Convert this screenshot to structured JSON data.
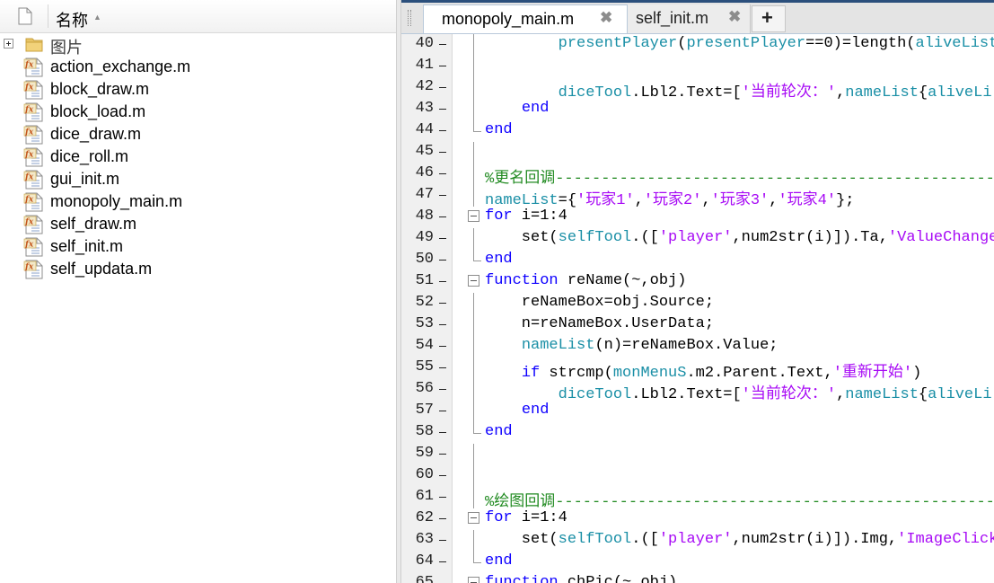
{
  "browser": {
    "header": {
      "name_label": "名称",
      "sort_glyph": "▲"
    },
    "folder": {
      "label": "图片",
      "icon": "folder-icon",
      "expander": "plus"
    },
    "files": [
      "action_exchange.m",
      "block_draw.m",
      "block_load.m",
      "dice_draw.m",
      "dice_roll.m",
      "gui_init.m",
      "monopoly_main.m",
      "self_draw.m",
      "self_init.m",
      "self_updata.m"
    ],
    "file_icon": "matlab-function-icon"
  },
  "editor": {
    "tabs": [
      {
        "label": "monopoly_main.m",
        "active": true
      },
      {
        "label": "self_init.m",
        "active": false
      }
    ],
    "close_glyph": "✖",
    "new_tab_glyph": "+",
    "lines": [
      {
        "n": "40",
        "segments": [
          [
            "plain",
            "        "
          ],
          [
            "var2",
            "presentPlayer"
          ],
          [
            "plain",
            "("
          ],
          [
            "var2",
            "presentPlayer"
          ],
          [
            "plain",
            "==0)=length("
          ],
          [
            "var2",
            "aliveList"
          ],
          [
            "plain",
            ")"
          ]
        ]
      },
      {
        "n": "41",
        "segments": []
      },
      {
        "n": "42",
        "segments": [
          [
            "plain",
            "        "
          ],
          [
            "var2",
            "diceTool"
          ],
          [
            "plain",
            ".Lbl2.Text=["
          ],
          [
            "str",
            "'当前轮次：'"
          ],
          [
            "plain",
            ","
          ],
          [
            "var2",
            "nameList"
          ],
          [
            "plain",
            "{"
          ],
          [
            "var2",
            "aliveLi"
          ]
        ]
      },
      {
        "n": "43",
        "segments": [
          [
            "plain",
            "    "
          ],
          [
            "kw",
            "end"
          ]
        ]
      },
      {
        "n": "44",
        "segments": [
          [
            "kw",
            "end"
          ]
        ]
      },
      {
        "n": "45",
        "segments": []
      },
      {
        "n": "46",
        "segments": [
          [
            "cmt",
            "%更名回调--------------------------------------------------"
          ]
        ]
      },
      {
        "n": "47",
        "segments": [
          [
            "var2",
            "nameList"
          ],
          [
            "plain",
            "={"
          ],
          [
            "str",
            "'玩家1'"
          ],
          [
            "plain",
            ","
          ],
          [
            "str",
            "'玩家2'"
          ],
          [
            "plain",
            ","
          ],
          [
            "str",
            "'玩家3'"
          ],
          [
            "plain",
            ","
          ],
          [
            "str",
            "'玩家4'"
          ],
          [
            "plain",
            "};"
          ]
        ]
      },
      {
        "n": "48",
        "segments": [
          [
            "kw",
            "for"
          ],
          [
            "plain",
            " i=1:4"
          ]
        ]
      },
      {
        "n": "49",
        "segments": [
          [
            "plain",
            "    set("
          ],
          [
            "var2",
            "selfTool"
          ],
          [
            "plain",
            ".(["
          ],
          [
            "str",
            "'player'"
          ],
          [
            "plain",
            ",num2str(i)]).Ta,"
          ],
          [
            "str",
            "'ValueChanged"
          ]
        ]
      },
      {
        "n": "50",
        "segments": [
          [
            "kw",
            "end"
          ]
        ]
      },
      {
        "n": "51",
        "segments": [
          [
            "kw",
            "function"
          ],
          [
            "plain",
            " reName(~,obj)"
          ]
        ]
      },
      {
        "n": "52",
        "segments": [
          [
            "plain",
            "    reNameBox=obj.Source;"
          ]
        ]
      },
      {
        "n": "53",
        "segments": [
          [
            "plain",
            "    n=reNameBox.UserData;"
          ]
        ]
      },
      {
        "n": "54",
        "segments": [
          [
            "plain",
            "    "
          ],
          [
            "var2",
            "nameList"
          ],
          [
            "plain",
            "(n)=reNameBox.Value;"
          ]
        ]
      },
      {
        "n": "55",
        "segments": [
          [
            "plain",
            "    "
          ],
          [
            "kw",
            "if"
          ],
          [
            "plain",
            " strcmp("
          ],
          [
            "var2",
            "monMenuS"
          ],
          [
            "plain",
            ".m2.Parent.Text,"
          ],
          [
            "str",
            "'重新开始'"
          ],
          [
            "plain",
            ")"
          ]
        ]
      },
      {
        "n": "56",
        "segments": [
          [
            "plain",
            "        "
          ],
          [
            "var2",
            "diceTool"
          ],
          [
            "plain",
            ".Lbl2.Text=["
          ],
          [
            "str",
            "'当前轮次：'"
          ],
          [
            "plain",
            ","
          ],
          [
            "var2",
            "nameList"
          ],
          [
            "plain",
            "{"
          ],
          [
            "var2",
            "aliveLi"
          ]
        ]
      },
      {
        "n": "57",
        "segments": [
          [
            "plain",
            "    "
          ],
          [
            "kw",
            "end"
          ]
        ]
      },
      {
        "n": "58",
        "segments": [
          [
            "kw",
            "end"
          ]
        ]
      },
      {
        "n": "59",
        "segments": []
      },
      {
        "n": "60",
        "segments": []
      },
      {
        "n": "61",
        "segments": [
          [
            "cmt",
            "%绘图回调--------------------------------------------------"
          ]
        ]
      },
      {
        "n": "62",
        "segments": [
          [
            "kw",
            "for"
          ],
          [
            "plain",
            " i=1:4"
          ]
        ]
      },
      {
        "n": "63",
        "segments": [
          [
            "plain",
            "    set("
          ],
          [
            "var2",
            "selfTool"
          ],
          [
            "plain",
            ".(["
          ],
          [
            "str",
            "'player'"
          ],
          [
            "plain",
            ",num2str(i)]).Img,"
          ],
          [
            "str",
            "'ImageClicke"
          ]
        ]
      },
      {
        "n": "64",
        "segments": [
          [
            "kw",
            "end"
          ]
        ]
      },
      {
        "n": "65",
        "segments": [
          [
            "kw",
            "function"
          ],
          [
            "plain",
            " chPic(~,obj)"
          ]
        ]
      }
    ]
  },
  "colors": {
    "keyword": "#0e00ff",
    "string": "#a709f5",
    "variable": "#1a8fa6",
    "comment": "#228b22",
    "tabbar_accent": "#2b4f7c"
  }
}
